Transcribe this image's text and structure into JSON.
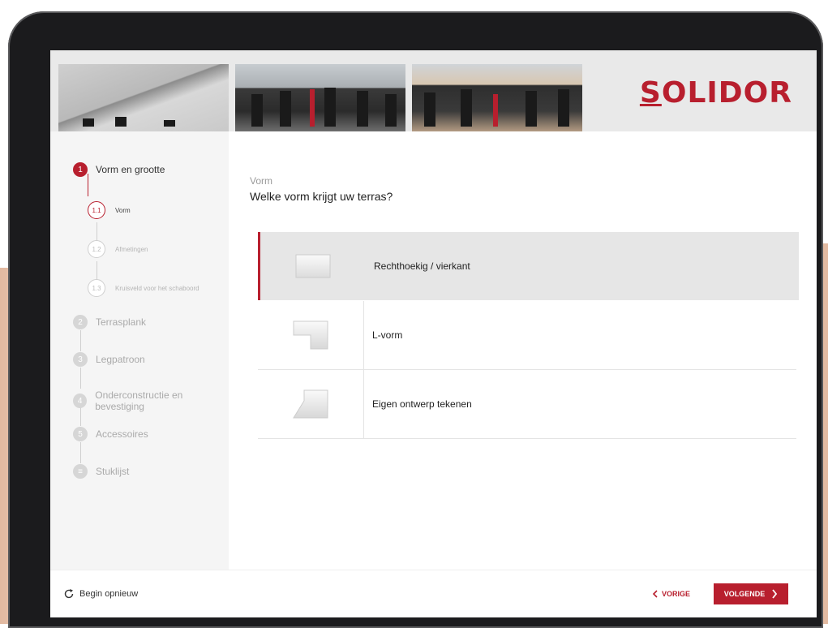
{
  "brand": {
    "logo_text": "SOLIDOR",
    "accent": "#b81f2e"
  },
  "sidebar": {
    "steps": [
      {
        "number": "1",
        "label": "Vorm en grootte"
      },
      {
        "number": "2",
        "label": "Terrasplank"
      },
      {
        "number": "3",
        "label": "Legpatroon"
      },
      {
        "number": "4",
        "label": "Onderconstructie en bevestiging"
      },
      {
        "number": "5",
        "label": "Accessoires"
      },
      {
        "number": "≡",
        "label": "Stuklijst"
      }
    ],
    "substeps": [
      {
        "number": "1.1",
        "label": "Vorm"
      },
      {
        "number": "1.2",
        "label": "Afmetingen"
      },
      {
        "number": "1.3",
        "label": "Kruisveld voor het schaboord"
      }
    ]
  },
  "main": {
    "category": "Vorm",
    "question": "Welke vorm krijgt uw terras?",
    "options": [
      {
        "label": "Rechthoekig / vierkant",
        "icon": "rectangle-shape-icon"
      },
      {
        "label": "L-vorm",
        "icon": "l-shape-icon"
      },
      {
        "label": "Eigen ontwerp tekenen",
        "icon": "custom-shape-icon"
      }
    ]
  },
  "footer": {
    "restart_label": "Begin opnieuw",
    "prev_label": "VORIGE",
    "next_label": "VOLGENDE"
  }
}
